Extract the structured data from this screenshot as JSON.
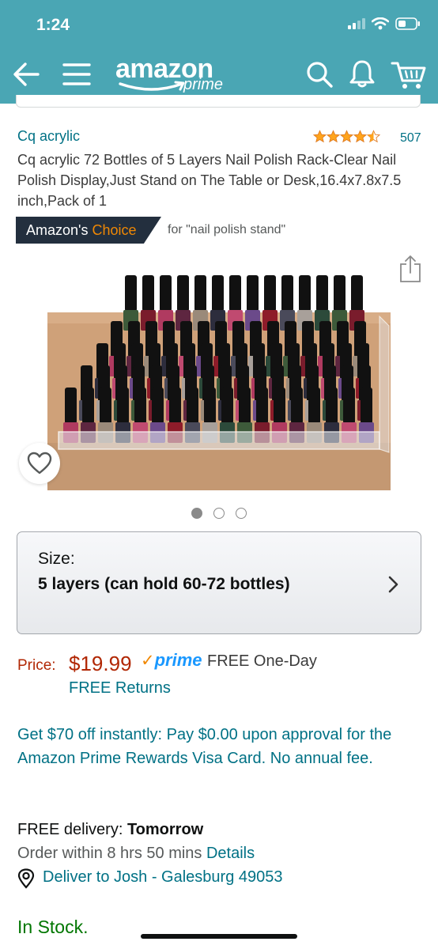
{
  "status_bar": {
    "time": "1:24"
  },
  "header": {
    "logo_text": "amazon",
    "logo_sub": "prime",
    "colors": {
      "background": "#4aa6b4"
    },
    "icons": [
      "back-arrow-icon",
      "hamburger-menu-icon",
      "search-icon",
      "bell-icon",
      "cart-icon"
    ]
  },
  "product": {
    "brand": "Cq acrylic",
    "rating_count": "507",
    "rating_stars": 4.5,
    "title": "Cq acrylic 72 Bottles of 5 Layers Nail Polish Rack-Clear Nail Polish Display,Just Stand on The Table or Desk,16.4x7.8x7.5 inch,Pack of 1",
    "badge_prefix": "Amazon's ",
    "badge_highlight": "Choice",
    "badge_for": "for \"nail polish stand\"",
    "image_count": 3,
    "active_image": 1
  },
  "size_selector": {
    "label": "Size:",
    "value": "5 layers (can hold 60-72 bottles)"
  },
  "pricing": {
    "price_label": "Price:",
    "price": "$19.99",
    "prime_check": "✓",
    "prime_word": "prime",
    "delivery_type": "FREE One-Day",
    "returns": "FREE Returns",
    "colors": {
      "price": "#b12704",
      "prime": "#1a98ff"
    }
  },
  "offer": {
    "text": "Get $70 off instantly: Pay $0.00 upon approval for the Amazon Prime Rewards Visa Card. No annual fee."
  },
  "delivery": {
    "prefix": "FREE delivery: ",
    "day": "Tomorrow",
    "order_within": "Order within 8 hrs 50 mins ",
    "details_link": "Details",
    "deliver_to": "Deliver to Josh - Galesburg 49053"
  },
  "stock": {
    "status": "In Stock.",
    "color": "#007600"
  }
}
